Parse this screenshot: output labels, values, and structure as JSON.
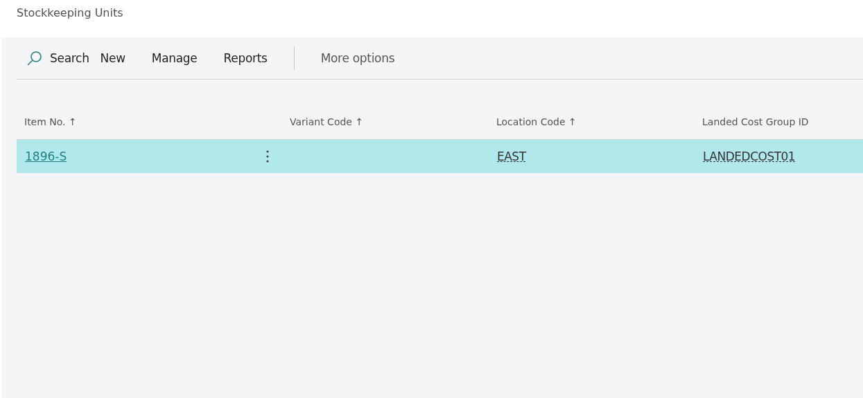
{
  "page_title": "Stockkeeping Units",
  "toolbar": {
    "search": "Search",
    "actions": [
      "New",
      "Manage",
      "Reports"
    ],
    "more": "More options"
  },
  "table": {
    "columns": [
      {
        "label": "Item No.",
        "sort": "↑"
      },
      {
        "label": "Variant Code",
        "sort": "↑"
      },
      {
        "label": "Location Code",
        "sort": "↑"
      },
      {
        "label": "Landed Cost Group ID"
      }
    ],
    "rows": [
      {
        "selected": true,
        "item_no": "1896-S",
        "location_code": "EAST",
        "landed_cost_group_id": "LANDEDCOST01"
      }
    ]
  }
}
